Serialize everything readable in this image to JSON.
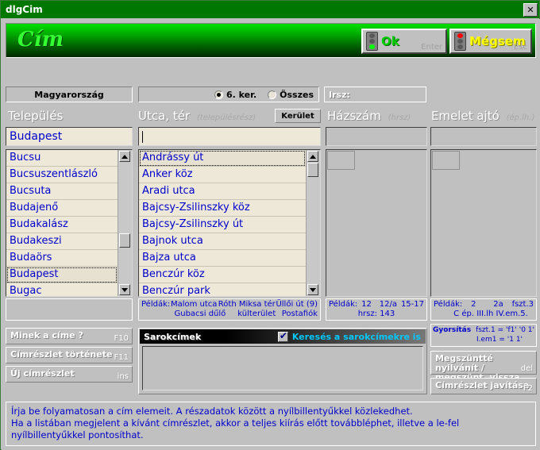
{
  "window": {
    "title": "dlgCim",
    "close_label": "✕"
  },
  "banner": {
    "title": "Cím"
  },
  "actions": {
    "ok_label": "Ok",
    "ok_key": "Enter",
    "cancel_label": "Mégsem",
    "cancel_key": "Esc"
  },
  "toprow": {
    "country_label": "Magyarország",
    "radio_district_label": "6. ker.",
    "radio_all_label": "Összes",
    "zip_label": "Irsz:"
  },
  "columns": {
    "telepules": {
      "title": "Település",
      "sub": ""
    },
    "utca": {
      "title": "Utca, tér",
      "sub": "(településrész)",
      "district_button": "Kerület"
    },
    "hazszam": {
      "title": "Házszám",
      "sub": "(hrsz)"
    },
    "emelet": {
      "title": "Emelet ajtó",
      "sub": "(ép.lh.)"
    }
  },
  "inputs": {
    "telepules_value": "Budapest",
    "utca_value": "",
    "hazszam_value": "",
    "emelet_value": ""
  },
  "telepules_list": [
    {
      "label": "Bucsu",
      "selected": false
    },
    {
      "label": "Bucsuszentlászló",
      "selected": false
    },
    {
      "label": "Bucsuta",
      "selected": false
    },
    {
      "label": "Budajenő",
      "selected": false
    },
    {
      "label": "Budakalász",
      "selected": false
    },
    {
      "label": "Budakeszi",
      "selected": false
    },
    {
      "label": "Budaörs",
      "selected": false
    },
    {
      "label": "Budapest",
      "selected": true
    },
    {
      "label": "Bugac",
      "selected": false
    }
  ],
  "utca_list": [
    {
      "label": "Andrássy út",
      "selected": true
    },
    {
      "label": "Anker köz",
      "selected": false
    },
    {
      "label": "Aradi utca",
      "selected": false
    },
    {
      "label": "Bajcsy-Zsilinszky köz",
      "selected": false
    },
    {
      "label": "Bajcsy-Zsilinszky út",
      "selected": false
    },
    {
      "label": "Bajnok utca",
      "selected": false
    },
    {
      "label": "Bajza utca",
      "selected": false
    },
    {
      "label": "Benczúr köz",
      "selected": false
    },
    {
      "label": "Benczúr park",
      "selected": false
    }
  ],
  "examples": {
    "utca": {
      "label": "Példák:",
      "row1_left": "Malom utca",
      "row1_mid": "Róth Miksa tér",
      "row1_right": "Üllői út (9)",
      "row2_left": "Gubacsi dűlő",
      "row2_mid": "külterület",
      "row2_right": "Postafiók"
    },
    "hazszam": {
      "label": "Példák:",
      "row1_left": "12",
      "row1_mid": "12/a",
      "row1_right": "15-17",
      "row2_mid": "hrsz: 143"
    },
    "emelet": {
      "label": "Példák:",
      "row1_left": "2",
      "row1_mid": "2a",
      "row1_right": "fszt.3",
      "row2_mid": "C ép. III.lh IV.em.5."
    }
  },
  "buttons": {
    "minek_label": "Minek a címe ?",
    "minek_key": "F10",
    "tortenete_label": "Címrészlet története",
    "tortenete_key": "F11",
    "uj_label": "Új címrészlet",
    "uj_key": "ins",
    "megszunt_label": "Megszüntté nyilvánít /\nmegszünt. vissza",
    "megszunt_key": "del",
    "javitas_label": "Címrészlet javítása",
    "javitas_key": "F2"
  },
  "gyorsitas": {
    "label": "Gyorsítás",
    "row1": "fszt.1 = 'f1'  '0 1'",
    "row2": "I.em1 = '1 1'"
  },
  "sarokcimek": {
    "title": "Sarokcímek",
    "checkbox_label": "Keresés a sarokcímekre is",
    "checked": true
  },
  "status": {
    "line1": "Írja be folyamatosan a cím elemeit. A részadatok között a nyílbillentyűkkel közlekedhet.",
    "line2": "Ha a listában megjelent a kívánt címrészlet, akkor a teljes kiírás előtt továbbléphet, illetve a le-fel nyílbillentyűkkel pontosíthat."
  },
  "colors": {
    "title_green": "#007800",
    "text_blue": "#0000cc",
    "cyan": "#00c8ff",
    "yellow": "#ffff00",
    "bright_green": "#00cc00"
  }
}
